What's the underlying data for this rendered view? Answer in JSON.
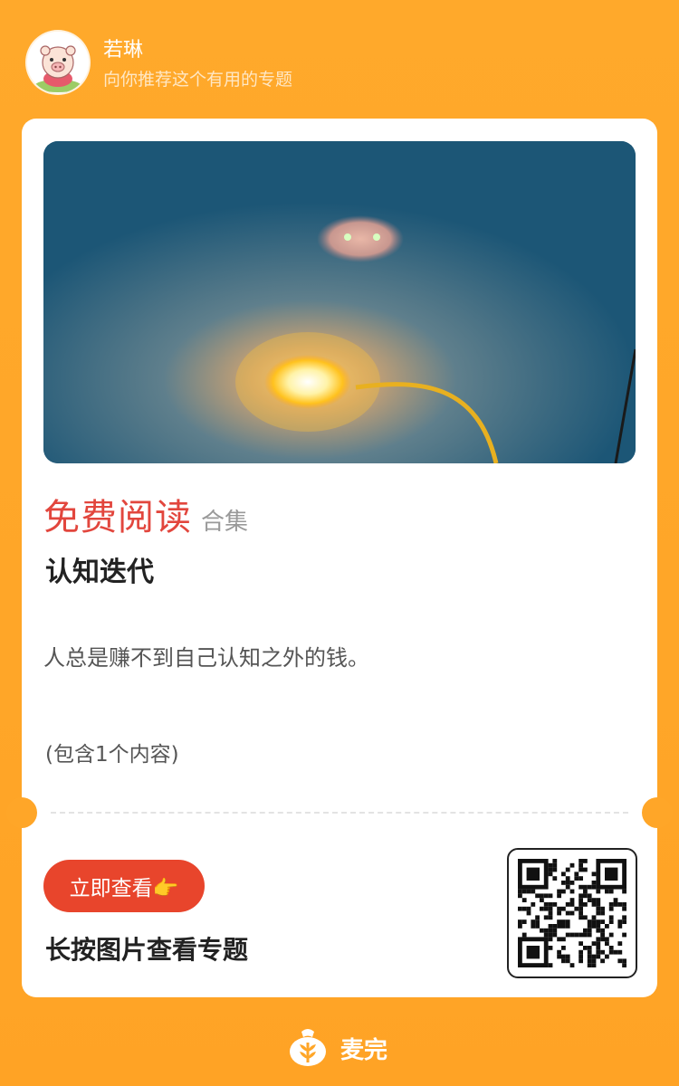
{
  "header": {
    "username": "若琳",
    "subtitle": "向你推荐这个有用的专题"
  },
  "card": {
    "free_read_label": "免费阅读",
    "collection_label": "合集",
    "topic_name": "认知迭代",
    "description": "人总是赚不到自己认知之外的钱。",
    "content_count": "(包含1个内容)",
    "view_button_label": "立即查看👉",
    "long_press_hint": "长按图片查看专题"
  },
  "footer": {
    "brand_name": "麦完"
  },
  "colors": {
    "background": "#ffa628",
    "accent_red": "#e2463d",
    "button_red": "#e8452c",
    "card": "#ffffff"
  },
  "icons": {
    "avatar": "cartoon-pig-avatar",
    "footer_logo": "wheat-bag-icon",
    "hero": "street-lamp-night-photo",
    "qr": "qr-code"
  }
}
